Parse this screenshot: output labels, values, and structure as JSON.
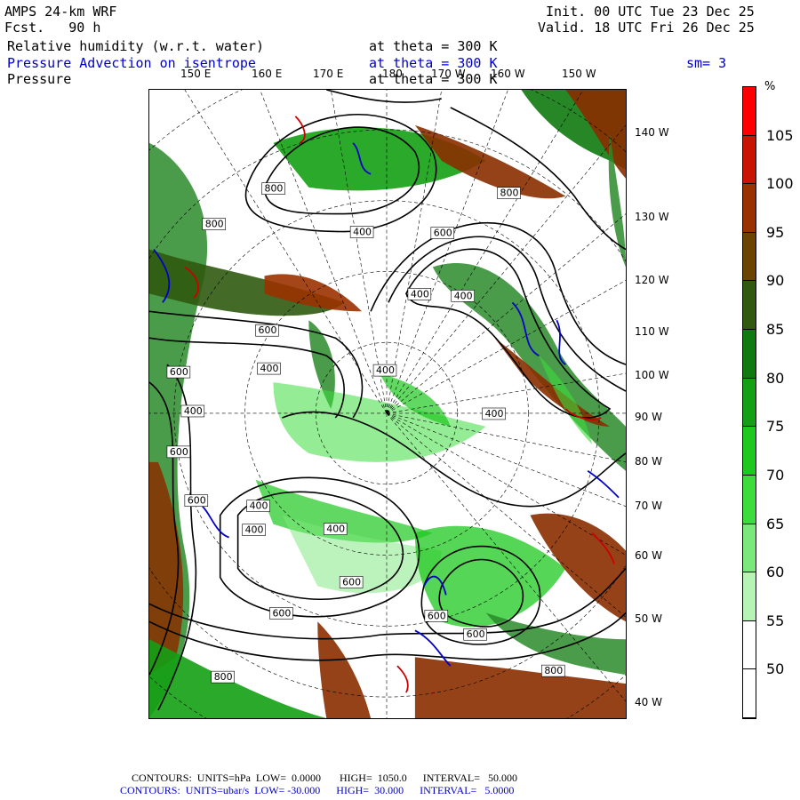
{
  "header": {
    "model": "AMPS 24-km WRF",
    "fcst": "Fcst.   90 h",
    "init": "Init. 00 UTC Tue 23 Dec 25",
    "valid": "Valid. 18 UTC Fri 26 Dec 25",
    "field1": "Relative humidity (w.r.t. water)",
    "field1_level": "at theta = 300 K",
    "field2": "Pressure Advection on isentrope",
    "field2_level": "at theta = 300 K",
    "field2_smooth": "sm= 3",
    "field3": "Pressure",
    "field3_level": "at theta = 300 K"
  },
  "lon_labels": [
    "150 E",
    "160 E",
    "170 E",
    "180",
    "170 W",
    "160 W",
    "150 W"
  ],
  "lat_labels": [
    "140 W",
    "130 W",
    "120 W",
    "110 W",
    "100 W",
    "90 W",
    "80 W",
    "70 W",
    "60 W",
    "50 W",
    "40 W"
  ],
  "contour_labels": [
    "800",
    "800",
    "800",
    "600",
    "400",
    "400",
    "400",
    "400",
    "400",
    "400",
    "400",
    "400",
    "400",
    "400",
    "600",
    "600",
    "600",
    "600",
    "600",
    "600",
    "600",
    "800",
    "800",
    "600"
  ],
  "colorbar": {
    "unit": "%",
    "labels": [
      "105",
      "100",
      "95",
      "90",
      "85",
      "80",
      "75",
      "70",
      "65",
      "60",
      "55",
      "50"
    ],
    "colors": [
      "#ff0000",
      "#c81400",
      "#9a3200",
      "#6a4400",
      "#2f5a10",
      "#0f7a0f",
      "#14a014",
      "#1ec81e",
      "#3cdc3c",
      "#7ae87a",
      "#b6f4b6",
      "#ffffff",
      "#ffffff"
    ]
  },
  "footer": {
    "line1": "CONTOURS:  UNITS=hPa  LOW=  0.0000       HIGH=  1050.0      INTERVAL=   50.000",
    "line2": "CONTOURS:  UNITS=ubar/s  LOW= -30.000      HIGH=  30.000      INTERVAL=   5.0000"
  }
}
